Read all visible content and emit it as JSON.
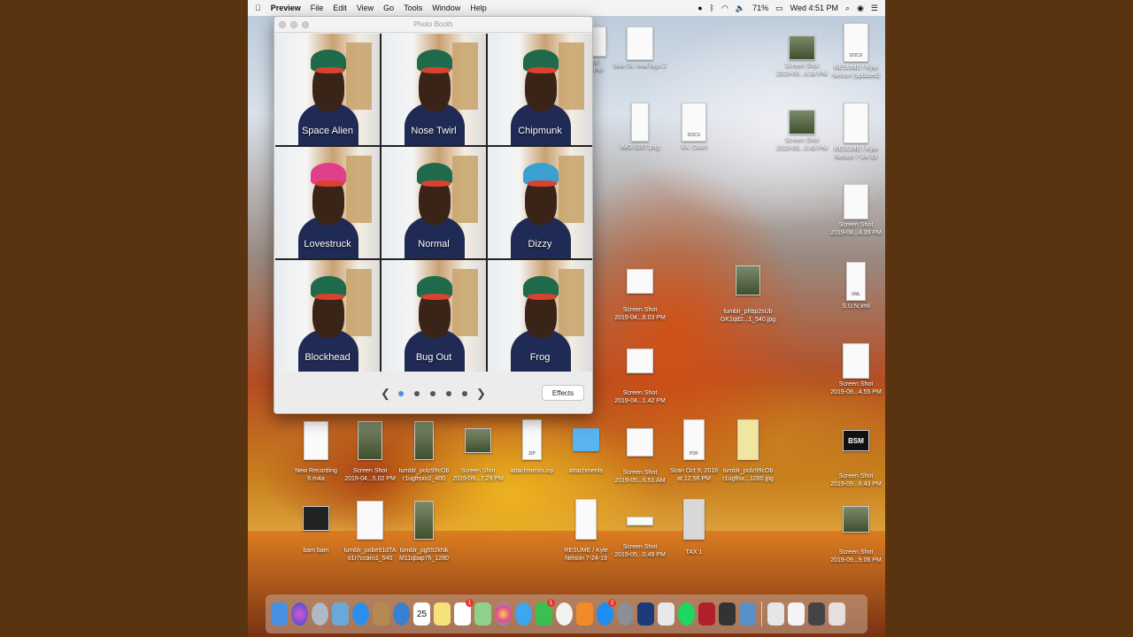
{
  "menubar": {
    "apple": "",
    "app": "Preview",
    "items": [
      "File",
      "Edit",
      "View",
      "Go",
      "Tools",
      "Window",
      "Help"
    ],
    "battery": "71%",
    "clock": "Wed 4:51 PM"
  },
  "photobooth": {
    "title": "Photo Booth",
    "effects": [
      "Space Alien",
      "Nose Twirl",
      "Chipmunk",
      "Lovestruck",
      "Normal",
      "Dizzy",
      "Blockhead",
      "Bug Out",
      "Frog"
    ],
    "effects_button": "Effects",
    "page_prev": "❮",
    "page_next": "❯"
  },
  "desktop": {
    "icons": [
      {
        "c1": "hot",
        "c2": "58 PM"
      },
      {
        "c1": "blue St. oval logo 2",
        "c2": ""
      },
      {
        "c1": "Screen Shot",
        "c2": "2019-09...9.38 PM"
      },
      {
        "c1": "RESUME / Kyle",
        "c2": "Nelson (updated)",
        "tag": "DOCX"
      },
      {
        "c1": "IMG 0167.png",
        "c2": ""
      },
      {
        "c1": "VA. Court",
        "c2": "",
        "tag": "DOCX"
      },
      {
        "c1": "Screen Shot",
        "c2": "2019-09...0.45 PM"
      },
      {
        "c1": "RESUME / Kyle",
        "c2": "Nelson 7-24-19"
      },
      {
        "c1": "Screen Shot",
        "c2": "2019-08...4.39 PM"
      },
      {
        "c1": "Screen Shot",
        "c2": "2019-04...8.03 PM"
      },
      {
        "c1": "tumblr_phbp2sUb",
        "c2": "GK1qd2...1_540.jpg"
      },
      {
        "c1": "S.U.N.xml",
        "c2": "",
        "tag": "XML"
      },
      {
        "c1": "Screen Shot",
        "c2": "2019-04...1.42 PM"
      },
      {
        "c1": "Screen Shot",
        "c2": "2019-08...4.55 PM"
      },
      {
        "c1": "New Recording",
        "c2": "6.m4a"
      },
      {
        "c1": "Screen Shot",
        "c2": "2019-04...5.02 PM"
      },
      {
        "c1": "tumblr_polz99cOb",
        "c2": "r1ugftsxo2_400"
      },
      {
        "c1": "Screen Shot",
        "c2": "2019-09...7.29 PM"
      },
      {
        "c1": "attachments.zip",
        "c2": "",
        "tag": "ZIP"
      },
      {
        "c1": "attachments",
        "c2": ""
      },
      {
        "c1": "Screen Shot",
        "c2": "2019-05...6.51 AM"
      },
      {
        "c1": "Scan Oct 9, 2018",
        "c2": "at 12.56 PM",
        "tag": "PDF"
      },
      {
        "c1": "tumblr_polz99cOb",
        "c2": "r1ugftsx...1280.jpg"
      },
      {
        "c1": "Screen Shot",
        "c2": "2019-09...8.43 PM",
        "tag": "BSM"
      },
      {
        "c1": "bam bam",
        "c2": ""
      },
      {
        "c1": "tumblr_pobe91dTA",
        "c2": "o1r7ccaro1_540"
      },
      {
        "c1": "tumblr_pg552kNk",
        "c2": "M11qbap7h_1280"
      },
      {
        "c1": "RESUME / Kyle",
        "c2": "Nelson 7-24-19"
      },
      {
        "c1": "Screen Shot",
        "c2": "2019-05...0.49 PM"
      },
      {
        "c1": "TAX 1",
        "c2": ""
      },
      {
        "c1": "Screen Shot",
        "c2": "2019-09...9.06 PM"
      }
    ]
  },
  "dock": {
    "apps": [
      "finder",
      "siri",
      "launchpad",
      "preview",
      "safari",
      "notes-brown",
      "system-clock",
      "calendar",
      "notes",
      "reminders",
      "maps",
      "photos",
      "messages",
      "facetime",
      "itunes",
      "books",
      "app-store",
      "system-preferences",
      "instruments",
      "preview2",
      "spotify",
      "photo-booth",
      "activity",
      "image-capture",
      "downloads",
      "documents",
      "screen",
      "trash"
    ],
    "calendar_day": "25",
    "badges": {
      "reminders": "1",
      "facetime": "1",
      "app-store": "2"
    }
  }
}
